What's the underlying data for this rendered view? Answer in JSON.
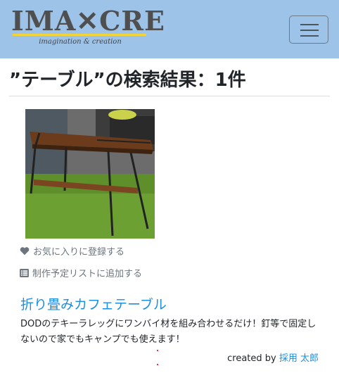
{
  "header": {
    "logo_text": "IMA✕CRE",
    "logo_tagline": "imagination & creation",
    "menu_icon": "hamburger-icon"
  },
  "search": {
    "heading": "”テーブル”の検索結果：1件"
  },
  "result": {
    "favorite_label": "お気に入りに登録する",
    "favorite_icon": "heart-icon",
    "plan_label": "制作予定リストに追加する",
    "plan_icon": "list-icon",
    "title": "折り畳みカフェテーブル",
    "description": "DODのテキーラレッグにワンバイ材を組み合わせるだけ！釘等で固定しないので家でもキャンプでも使えます！",
    "created_by_prefix": "created by ",
    "author": "採用 太郎"
  },
  "colors": {
    "navbar": "#9dc3e8",
    "link": "#1a8fe3",
    "muted": "#6c757d"
  }
}
